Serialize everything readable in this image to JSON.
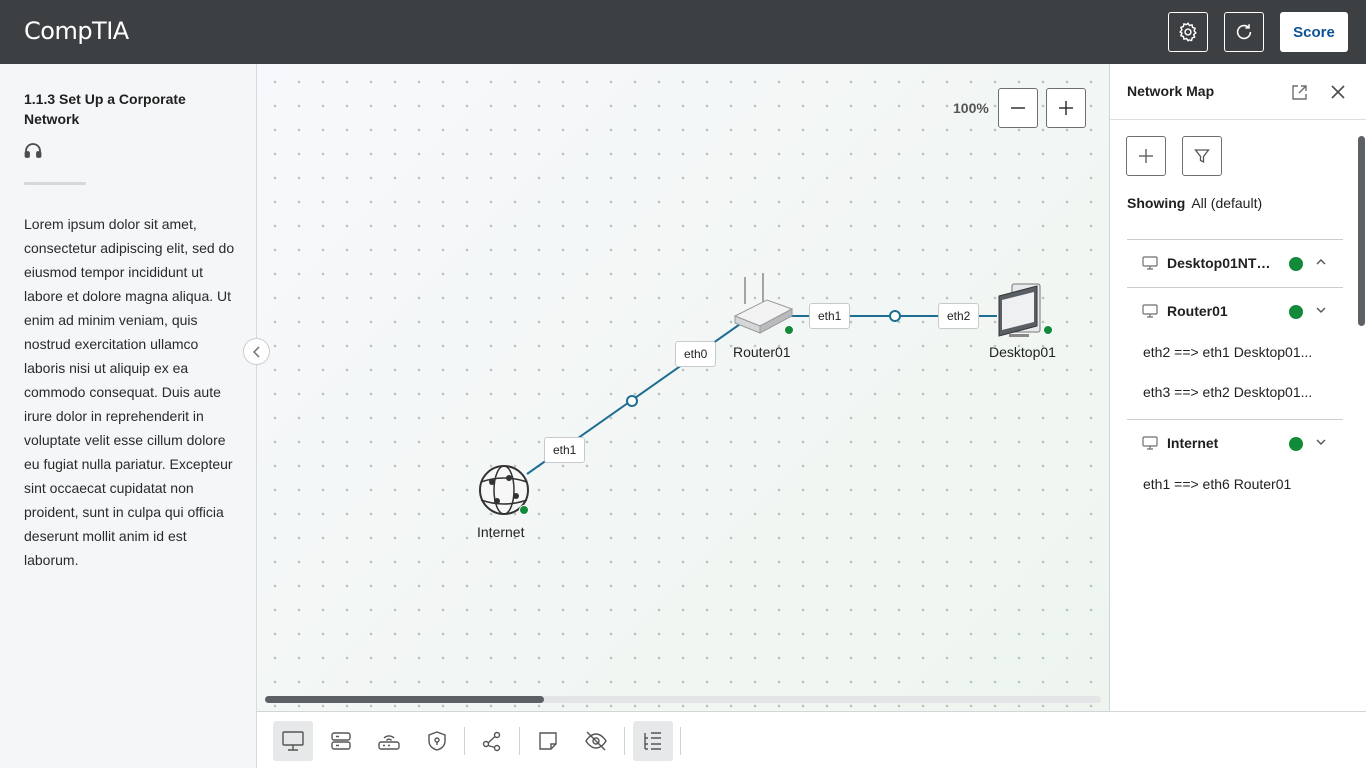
{
  "header": {
    "logo": "CompTIA",
    "score_label": "Score"
  },
  "lesson": {
    "title": "1.1.3 Set Up a Corporate Network",
    "body": "Lorem ipsum dolor sit amet, consectetur adipiscing elit, sed do eiusmod tempor incididunt ut labore et dolore magna aliqua. Ut enim ad minim veniam, quis nostrud exercitation ullamco laboris nisi ut aliquip ex ea commodo consequat. Duis aute irure dolor in reprehenderit in voluptate velit esse cillum dolore eu fugiat nulla pariatur. Excepteur sint occaecat cupidatat non proident, sunt in culpa qui officia deserunt mollit anim id est laborum."
  },
  "canvas": {
    "zoom": "100%",
    "nodes": {
      "router": "Router01",
      "desktop": "Desktop01",
      "internet": "Internet"
    },
    "ports": {
      "router_left": "eth0",
      "router_right": "eth1",
      "desktop": "eth2",
      "internet": "eth1"
    }
  },
  "network_map": {
    "title": "Network Map",
    "showing_label": "Showing",
    "showing_value": "All (default)",
    "devices": [
      {
        "name": "Desktop01NTB...",
        "status": "online",
        "connections": []
      },
      {
        "name": "Router01",
        "status": "online",
        "connections": [
          "eth2 ==> eth1 Desktop01...",
          "eth3 ==> eth2 Desktop01..."
        ]
      },
      {
        "name": "Internet",
        "status": "online",
        "connections": [
          "eth1 ==> eth6 Router01"
        ]
      }
    ]
  },
  "colors": {
    "topbar": "#3d4043",
    "status_online": "#118a3a",
    "link_line": "#1f6e91",
    "score_text": "#0b5394"
  }
}
